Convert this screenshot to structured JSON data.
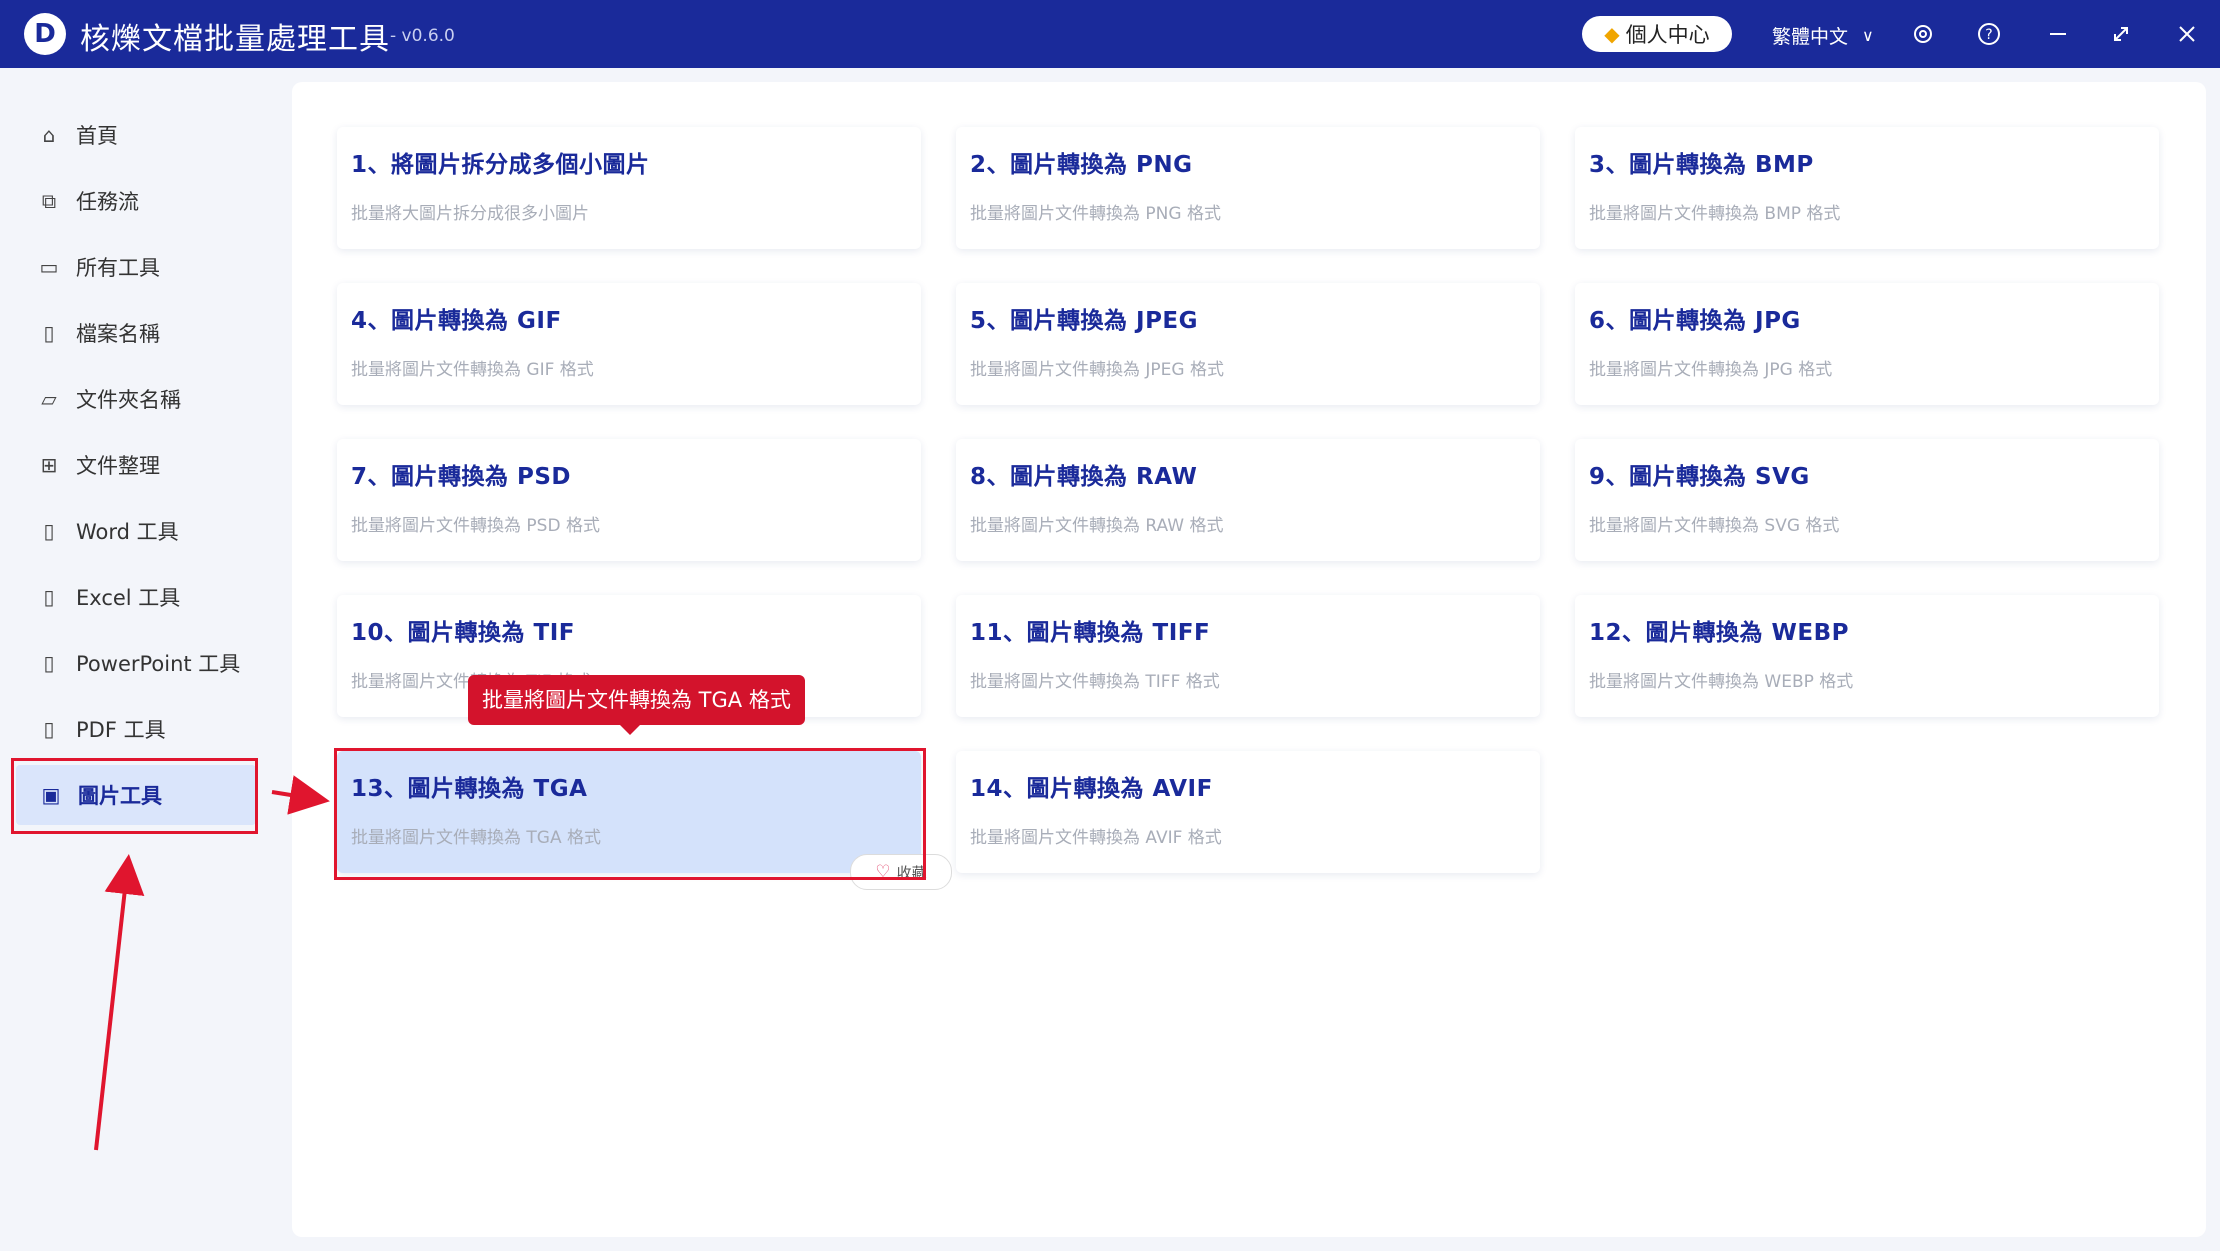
{
  "app": {
    "title": "核爍文檔批量處理工具",
    "version": "- v0.6.0",
    "logo_letter": "D"
  },
  "titlebar": {
    "user_center": "個人中心",
    "language": "繁體中文",
    "icons": [
      "gear-icon",
      "help-icon",
      "minimize-icon",
      "maximize-icon",
      "close-icon"
    ]
  },
  "sidebar": {
    "items": [
      {
        "label": "首頁",
        "icon": "home-icon"
      },
      {
        "label": "任務流",
        "icon": "workflow-icon"
      },
      {
        "label": "所有工具",
        "icon": "monitor-icon"
      },
      {
        "label": "檔案名稱",
        "icon": "file-icon"
      },
      {
        "label": "文件夾名稱",
        "icon": "folder-icon"
      },
      {
        "label": "文件整理",
        "icon": "organize-icon"
      },
      {
        "label": "Word 工具",
        "icon": "word-icon"
      },
      {
        "label": "Excel 工具",
        "icon": "excel-icon"
      },
      {
        "label": "PowerPoint 工具",
        "icon": "ppt-icon"
      },
      {
        "label": "PDF 工具",
        "icon": "pdf-icon"
      },
      {
        "label": "圖片工具",
        "icon": "image-icon",
        "active": true
      }
    ]
  },
  "tools": [
    {
      "title": "1、將圖片拆分成多個小圖片",
      "desc": "批量將大圖片拆分成很多小圖片"
    },
    {
      "title": "2、圖片轉換為 PNG",
      "desc": "批量將圖片文件轉換為 PNG 格式"
    },
    {
      "title": "3、圖片轉換為 BMP",
      "desc": "批量將圖片文件轉換為 BMP 格式"
    },
    {
      "title": "4、圖片轉換為 GIF",
      "desc": "批量將圖片文件轉換為 GIF 格式"
    },
    {
      "title": "5、圖片轉換為 JPEG",
      "desc": "批量將圖片文件轉換為 JPEG 格式"
    },
    {
      "title": "6、圖片轉換為 JPG",
      "desc": "批量將圖片文件轉換為 JPG 格式"
    },
    {
      "title": "7、圖片轉換為 PSD",
      "desc": "批量將圖片文件轉換為 PSD 格式"
    },
    {
      "title": "8、圖片轉換為 RAW",
      "desc": "批量將圖片文件轉換為 RAW 格式"
    },
    {
      "title": "9、圖片轉換為 SVG",
      "desc": "批量將圖片文件轉換為 SVG 格式"
    },
    {
      "title": "10、圖片轉換為 TIF",
      "desc": "批量將圖片文件轉換為 TIF 格式"
    },
    {
      "title": "11、圖片轉換為 TIFF",
      "desc": "批量將圖片文件轉換為 TIFF 格式"
    },
    {
      "title": "12、圖片轉換為 WEBP",
      "desc": "批量將圖片文件轉換為 WEBP 格式"
    },
    {
      "title": "13、圖片轉換為 TGA",
      "desc": "批量將圖片文件轉換為 TGA 格式",
      "selected": true
    },
    {
      "title": "14、圖片轉換為 AVIF",
      "desc": "批量將圖片文件轉換為 AVIF 格式"
    }
  ],
  "tooltip": "批量將圖片文件轉換為 TGA 格式",
  "favorite_label": "收藏",
  "colors": {
    "brand": "#1a2a9a",
    "selected_card": "#d4e2fb",
    "annotation_red": "#e0152e",
    "tooltip_red": "#d3132c"
  }
}
